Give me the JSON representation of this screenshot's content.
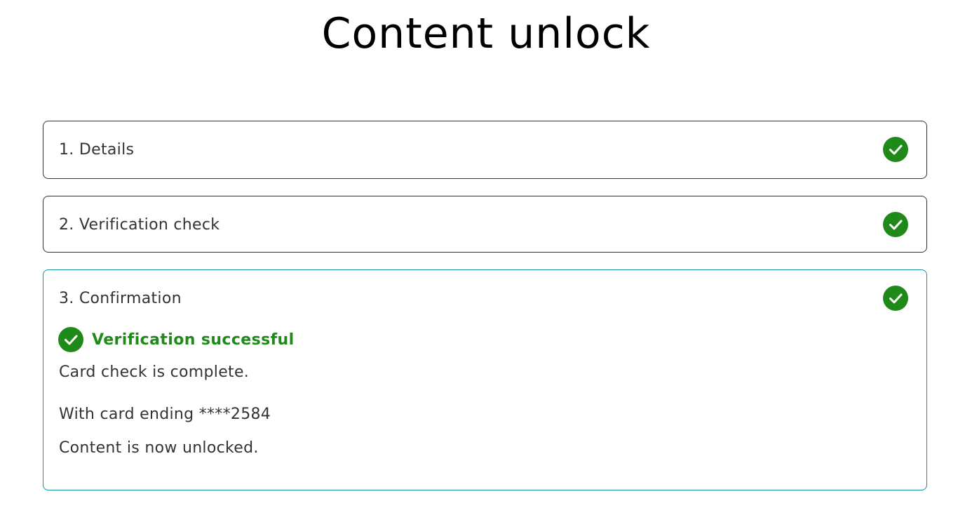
{
  "page": {
    "title": "Content unlock"
  },
  "colors": {
    "success_green": "#1f8a1a",
    "active_border": "#17939b",
    "default_border": "#333333",
    "text": "#333333"
  },
  "steps": [
    {
      "label": "1. Details",
      "status_icon": "check-circle-icon",
      "complete": true
    },
    {
      "label": "2. Verification check",
      "status_icon": "check-circle-icon",
      "complete": true
    },
    {
      "label": "3. Confirmation",
      "status_icon": "check-circle-icon",
      "complete": true
    }
  ],
  "confirmation": {
    "success_heading": "Verification successful",
    "success_icon": "check-circle-icon",
    "message_1": "Card check is complete.",
    "message_2": "With card ending ****2584",
    "message_3": "Content is now unlocked."
  }
}
